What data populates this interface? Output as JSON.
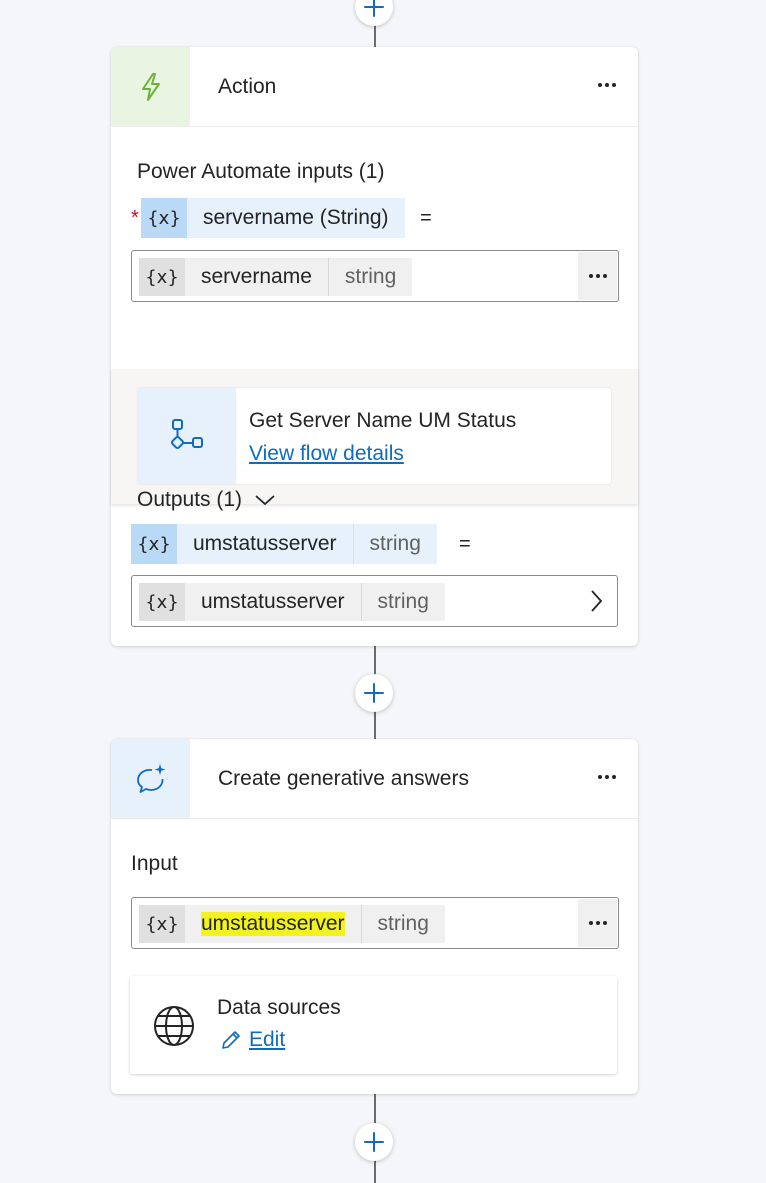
{
  "action_card": {
    "title": "Action",
    "inputs_label": "Power Automate inputs (1)",
    "required_mark": "*",
    "input_param": {
      "name": "servername (String)"
    },
    "equals": "=",
    "input_value": {
      "name": "servername",
      "type": "string"
    },
    "flow": {
      "name": "Get Server Name UM Status",
      "link": "View flow details"
    },
    "outputs_label": "Outputs (1)",
    "output_var": {
      "name": "umstatusserver",
      "type": "string"
    },
    "output_value": {
      "name": "umstatusserver",
      "type": "string"
    }
  },
  "generative_card": {
    "title": "Create generative answers",
    "input_label": "Input",
    "input_value": {
      "name": "umstatusserver",
      "type": "string"
    },
    "data_sources": {
      "title": "Data sources",
      "edit": "Edit"
    }
  },
  "variable_symbol": "{x}",
  "colors": {
    "accent": "#0f6cbd",
    "action_icon_bg": "#eaf5e1",
    "action_icon": "#6bb33a",
    "gen_icon_bg": "#e7f1fb",
    "var_tag_bg": "#e6f1fb",
    "var_tag_x_bg": "#b9d9f6",
    "highlight": "#f2f21f"
  },
  "icons": [
    "plus-icon",
    "lightning-icon",
    "flow-icon",
    "chevron-down-icon",
    "chevron-right-icon",
    "sparkle-chat-icon",
    "globe-icon",
    "pencil-icon",
    "more-icon"
  ]
}
